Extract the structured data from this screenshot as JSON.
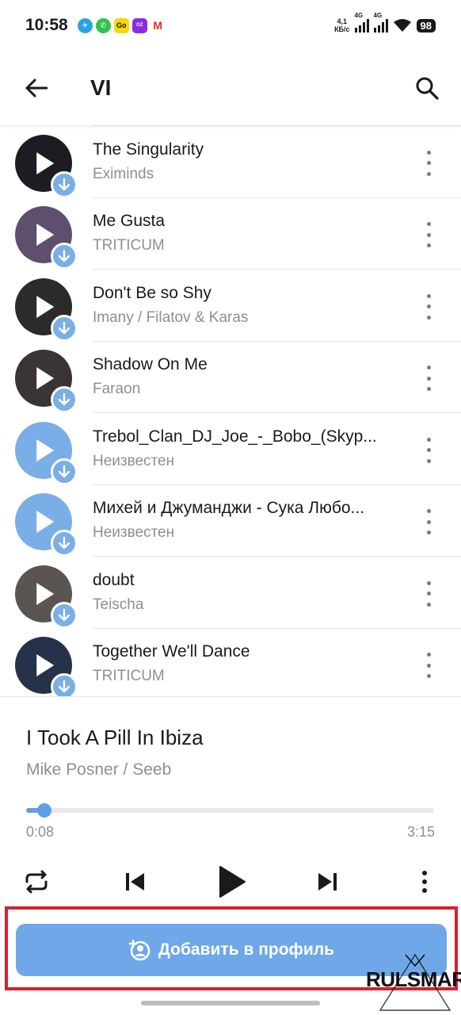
{
  "status_bar": {
    "time": "10:58",
    "net_speed_value": "4,1",
    "net_speed_unit": "КБ/с",
    "signal1_label": "4G",
    "signal2_label": "4G",
    "battery": "98"
  },
  "header": {
    "title": "VI",
    "back_icon": "arrow-left-icon",
    "search_icon": "search-icon"
  },
  "tracks": [
    {
      "title": "",
      "artist": "Неизвестен",
      "cover_color": "#7aaee6"
    },
    {
      "title": "The Singularity",
      "artist": "Eximinds",
      "cover_color": "#1c1c22"
    },
    {
      "title": "Me Gusta",
      "artist": "TRITICUM",
      "cover_color": "#5d4f6e"
    },
    {
      "title": "Don't Be so Shy",
      "artist": "Imany / Filatov & Karas",
      "cover_color": "#2b2b2b"
    },
    {
      "title": "Shadow On Me",
      "artist": "Faraon",
      "cover_color": "#3a3434"
    },
    {
      "title": "Trebol_Clan_DJ_Joe_-_Bobo_(Skyp...",
      "artist": "Неизвестен",
      "cover_color": "#7aaee6"
    },
    {
      "title": "Михей и Джуманджи - Сука Любо...",
      "artist": "Неизвестен",
      "cover_color": "#7aaee6"
    },
    {
      "title": "doubt",
      "artist": "Teischa",
      "cover_color": "#5a5550"
    },
    {
      "title": "Together We'll Dance",
      "artist": "TRITICUM",
      "cover_color": "#26314a"
    }
  ],
  "player": {
    "title": "I Took A Pill In Ibiza",
    "artist": "Mike Posner / Seeb",
    "current_time": "0:08",
    "total_time": "3:15",
    "progress_fraction": 0.045,
    "accent_color": "#5f9fe6"
  },
  "add_button": {
    "label": "Добавить в профиль",
    "icon": "add-user-icon"
  },
  "watermark": "RULSMART"
}
